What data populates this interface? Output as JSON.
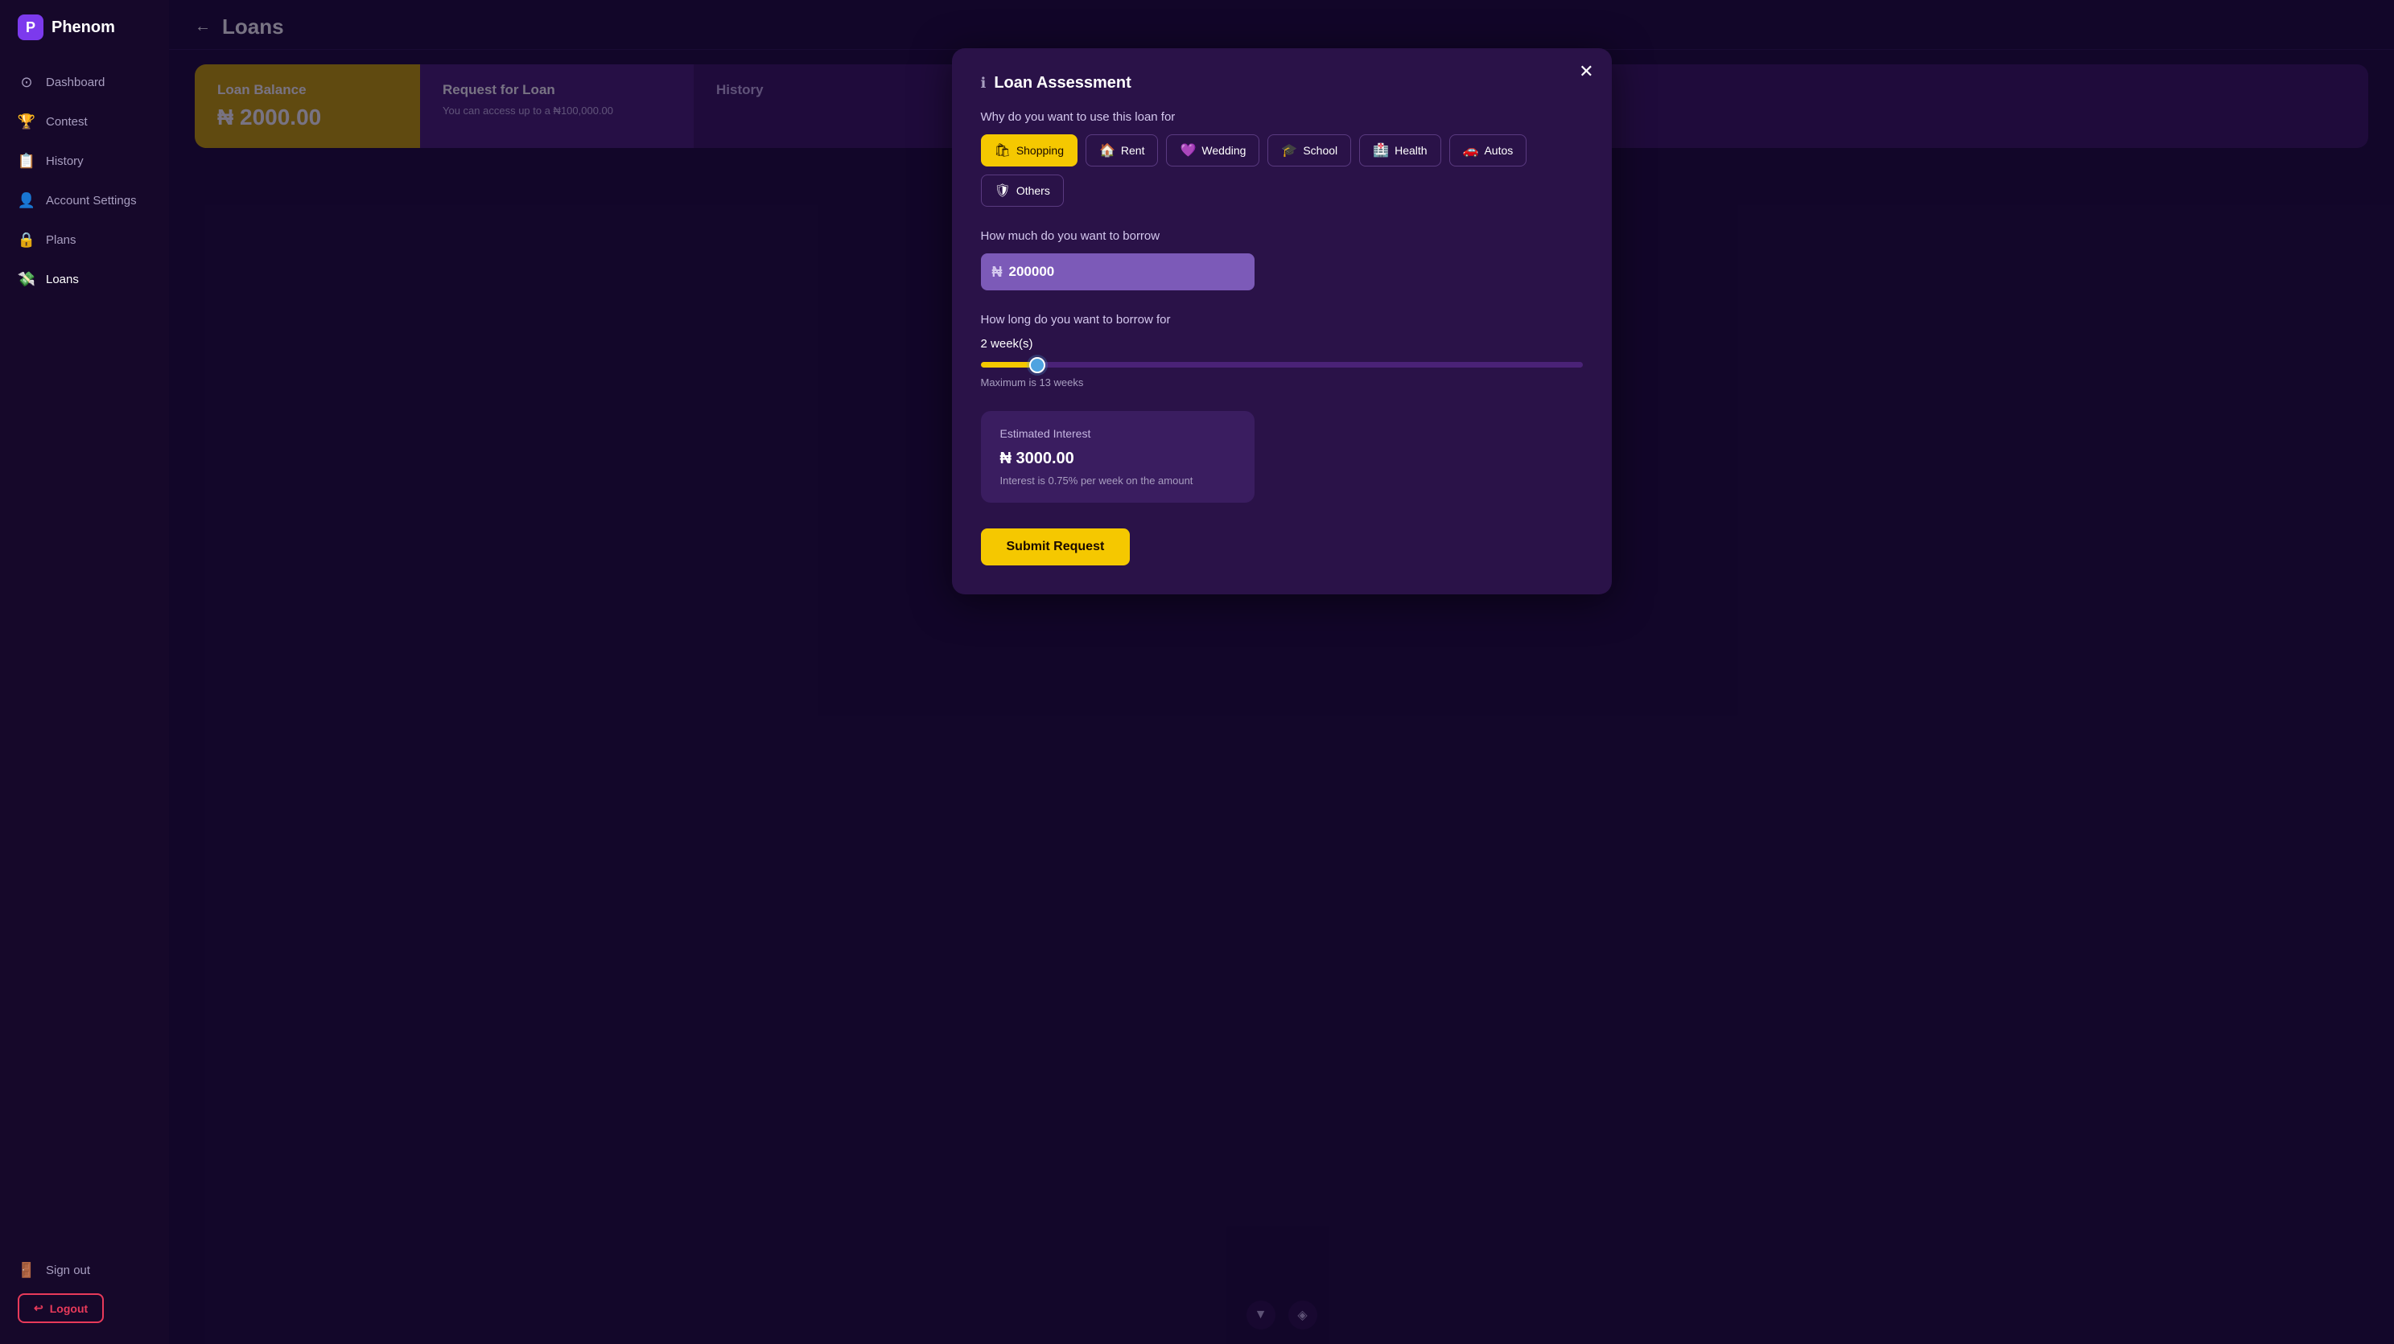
{
  "app": {
    "name": "Phenom",
    "logo_char": "P"
  },
  "sidebar": {
    "nav_items": [
      {
        "id": "dashboard",
        "label": "Dashboard",
        "icon": "⊙"
      },
      {
        "id": "contest",
        "label": "Contest",
        "icon": "🏆"
      },
      {
        "id": "history",
        "label": "History",
        "icon": "📋"
      },
      {
        "id": "account-settings",
        "label": "Account Settings",
        "icon": "👤"
      },
      {
        "id": "plans",
        "label": "Plans",
        "icon": "🔒"
      },
      {
        "id": "loans",
        "label": "Loans",
        "icon": "💸"
      }
    ],
    "signout_label": "Sign out",
    "logout_label": "Logout"
  },
  "header": {
    "back_label": "←",
    "title": "Loans"
  },
  "cards": {
    "balance": {
      "title": "Loan Balance",
      "amount": "₦ 2000.00"
    },
    "request": {
      "title": "Request for Loan",
      "subtitle": "You can access up to a ₦100,000.00"
    },
    "history": {
      "title": "History"
    }
  },
  "modal": {
    "title": "Loan Assessment",
    "close_label": "✕",
    "info_icon": "ℹ",
    "purpose_label": "Why do you want to use this loan for",
    "purpose_options": [
      {
        "id": "shopping",
        "label": "Shopping",
        "icon": "🛍",
        "active": true
      },
      {
        "id": "rent",
        "label": "Rent",
        "icon": "🏠",
        "active": false
      },
      {
        "id": "wedding",
        "label": "Wedding",
        "icon": "💜",
        "active": false
      },
      {
        "id": "school",
        "label": "School",
        "icon": "🎓",
        "active": false
      },
      {
        "id": "health",
        "label": "Health",
        "icon": "🏥",
        "active": false
      },
      {
        "id": "autos",
        "label": "Autos",
        "icon": "🚗",
        "active": false
      },
      {
        "id": "others",
        "label": "Others",
        "icon": "🛡",
        "active": false
      }
    ],
    "amount_label": "How much do you want to borrow",
    "amount_value": "200000",
    "amount_placeholder": "200000",
    "duration_label": "How long do you want to borrow for",
    "weeks_value": "2",
    "weeks_unit": "week(s)",
    "max_label": "Maximum is 13 weeks",
    "slider_min": 1,
    "slider_max": 13,
    "slider_value": 2,
    "interest": {
      "title": "Estimated Interest",
      "amount": "₦ 3000.00",
      "note": "Interest is 0.75% per week on the amount"
    },
    "submit_label": "Submit Request"
  },
  "bottom": {
    "icon1": "▼",
    "icon2": "◈"
  }
}
